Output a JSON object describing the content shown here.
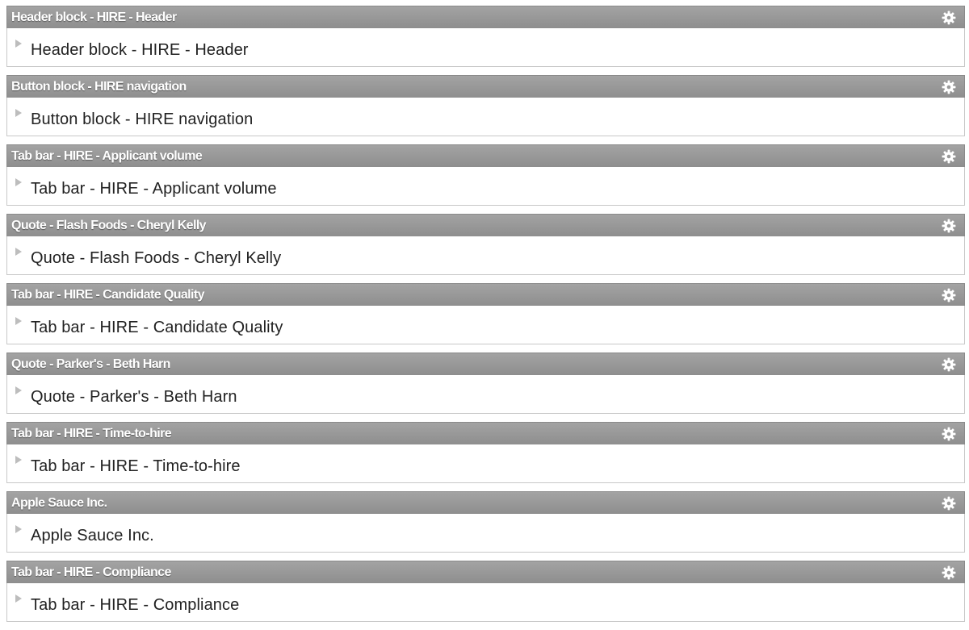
{
  "colors": {
    "header_bg": "#969696",
    "header_text": "#ffffff",
    "body_bg": "#ffffff",
    "body_text": "#222222",
    "arrow": "#bdbdbd",
    "gear": "#ffffff"
  },
  "icons": {
    "settings": "gear-icon",
    "expand": "triangle-right-icon"
  },
  "blocks": [
    {
      "title": "Header block - HIRE - Header",
      "label": "Header block - HIRE - Header"
    },
    {
      "title": "Button block - HIRE navigation",
      "label": "Button block - HIRE navigation"
    },
    {
      "title": "Tab bar - HIRE - Applicant volume",
      "label": "Tab bar - HIRE - Applicant volume"
    },
    {
      "title": "Quote - Flash Foods - Cheryl Kelly",
      "label": "Quote - Flash Foods - Cheryl Kelly"
    },
    {
      "title": "Tab bar - HIRE - Candidate Quality",
      "label": "Tab bar - HIRE - Candidate Quality"
    },
    {
      "title": "Quote - Parker's - Beth Harn",
      "label": "Quote - Parker's - Beth Harn"
    },
    {
      "title": "Tab bar - HIRE - Time-to-hire",
      "label": "Tab bar - HIRE - Time-to-hire"
    },
    {
      "title": "Apple Sauce Inc.",
      "label": "Apple Sauce Inc."
    },
    {
      "title": "Tab bar - HIRE - Compliance",
      "label": "Tab bar - HIRE - Compliance"
    }
  ]
}
